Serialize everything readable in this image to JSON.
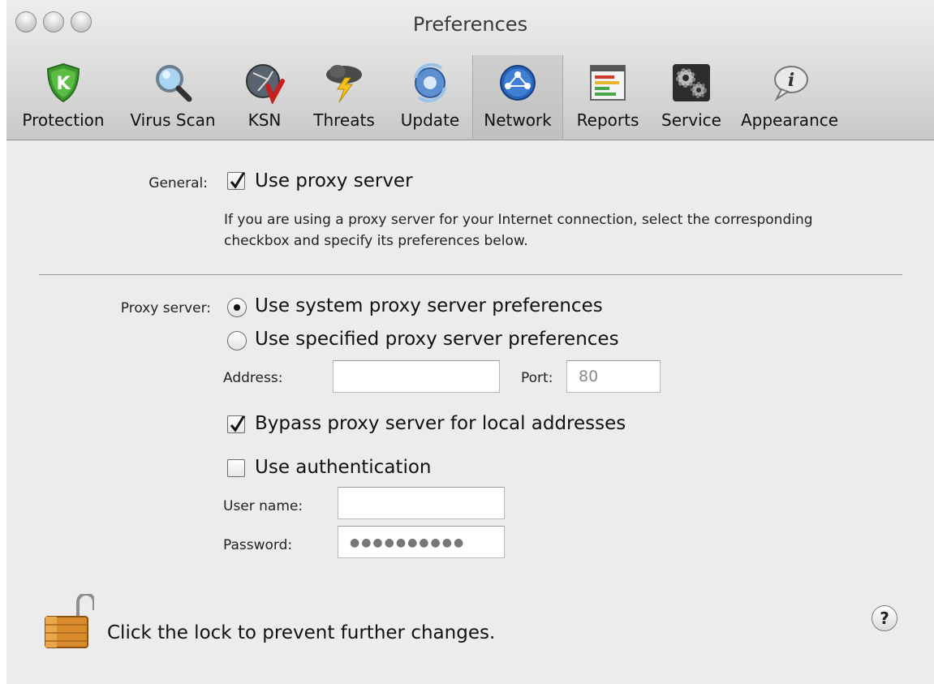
{
  "window": {
    "title": "Preferences"
  },
  "toolbar": {
    "items": [
      {
        "label": "Protection",
        "icon": "shield-icon"
      },
      {
        "label": "Virus Scan",
        "icon": "magnifier-icon"
      },
      {
        "label": "KSN",
        "icon": "network-globe-icon"
      },
      {
        "label": "Threats",
        "icon": "storm-cloud-icon"
      },
      {
        "label": "Update",
        "icon": "update-globe-icon"
      },
      {
        "label": "Network",
        "icon": "network-icon",
        "selected": true
      },
      {
        "label": "Reports",
        "icon": "reports-icon"
      },
      {
        "label": "Service",
        "icon": "gears-icon"
      },
      {
        "label": "Appearance",
        "icon": "info-bubble-icon"
      }
    ]
  },
  "general": {
    "label": "General:",
    "use_proxy_label": "Use proxy server",
    "use_proxy_checked": true,
    "description": "If you are using a proxy server for your Internet connection, select the corresponding checkbox and specify its preferences below."
  },
  "proxy": {
    "label": "Proxy server:",
    "option_system": "Use system proxy server preferences",
    "option_specified": "Use specified proxy server preferences",
    "selected_option": "system",
    "address_label": "Address:",
    "address_value": "",
    "port_label": "Port:",
    "port_value": "80",
    "bypass_label": "Bypass proxy server for local addresses",
    "bypass_checked": true,
    "auth_label": "Use authentication",
    "auth_checked": false,
    "username_label": "User name:",
    "username_value": "",
    "password_label": "Password:",
    "password_value": "●●●●●●●●●●"
  },
  "footer": {
    "lock_text": "Click the lock to prevent further changes.",
    "help_symbol": "?"
  }
}
